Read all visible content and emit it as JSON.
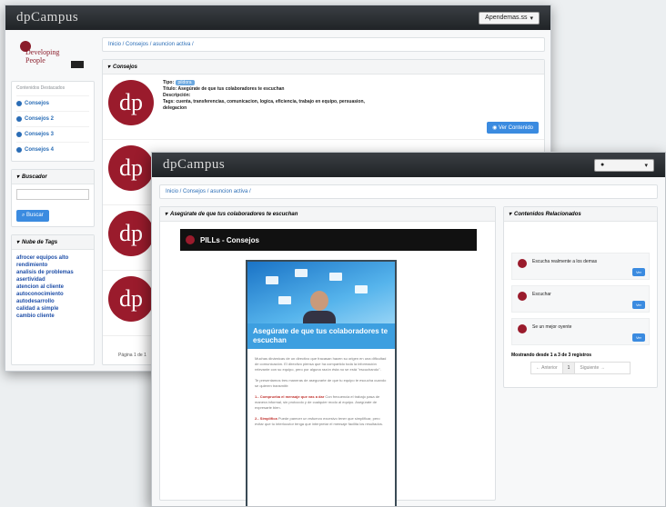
{
  "back": {
    "brand": "dpCampus",
    "user_label": "Apendemas.ss",
    "logo_text": "Developing\nPeople",
    "sidebar": {
      "cat_intro": "Contenidos\nDestacados",
      "categories": [
        "Consejos",
        "Consejos 2",
        "Consejos 3",
        "Consejos 4"
      ],
      "buscador_title": "Buscador",
      "search_button": "Buscar",
      "tags_title": "Nube de Tags",
      "tags": [
        "afrocer equipos alto rendimiento",
        "analisis de problemas",
        "asertividad",
        "atencion al cliente",
        "autoconocimiento",
        "autodesarrollo",
        "calidad a simple",
        "cambio cliente"
      ]
    },
    "breadcrumb": "Inicio  /  Consejos  /  asuncion activa  /",
    "consejos_title": "Consejos",
    "item": {
      "tipo_label": "Tipo:",
      "tipo_value": "pildora",
      "titulo": "Título: Asegúrate de que tus colaboradores te escuchan",
      "descripcion": "Descripción:",
      "tags": "Tags: cuenta, transferencias, comunicacion, logica, eficiencia, trabajo en equipo, persuasion,",
      "tags2": "delegacion",
      "ver_button": "Ver Contenido"
    },
    "pager": "Página 1 de 1"
  },
  "front": {
    "brand": "dpCampus",
    "user_label": "",
    "breadcrumb": "Inicio  /  Consejos  /  asuncion activa  /",
    "main_title": "Asegúrate de que tus colaboradores te escuchan",
    "banner": "PILLs - Consejos",
    "pill_title": "Asegúrate de que tus colaboradores te escuchan",
    "pill_p1": "Muchas dinámicas de un directivo que fracasan hacen su origen en una dificultad de comunicación. El directivo piensa que ha compartido toda la información relevante con su equipo, pero por alguna razón ésta no se está \"escuchando\".",
    "pill_p2": "Te presentamos tres maneras de asegurarte de que tu equipo te escucha cuando se quieren transmitir:",
    "pill_h1": "1.- Comprueba el mensaje que vas a dar",
    "pill_p3": "Con frecuencia el trabajo pasa de manera informal, sin protocolo y de cualquier modo al equipo. Asegúrate de expresarte bien.",
    "pill_h2": "2.- Simplifica",
    "pill_p4": "Puede parecer un esfuerzo excesivo tener que simplificar, pero evitar que tu interlocutor tenga que interpretar el mensaje facilita los resultados.",
    "related_title": "Contenidos Relacionados",
    "related": [
      "Escucha realmente a los demas",
      "Escuchar",
      "Se un mejor oyente"
    ],
    "ver_label": "Ver",
    "showing": "Mostrando desde 1 a 3 de 3 registros",
    "pager_prev": "← Anterior",
    "pager_cur": "1",
    "pager_next": "Siguiente →"
  },
  "colors": {
    "topbar": "#26292c",
    "brand_red": "#9a1b2c",
    "link_blue": "#2a6db6",
    "button_blue": "#3b8be0"
  }
}
